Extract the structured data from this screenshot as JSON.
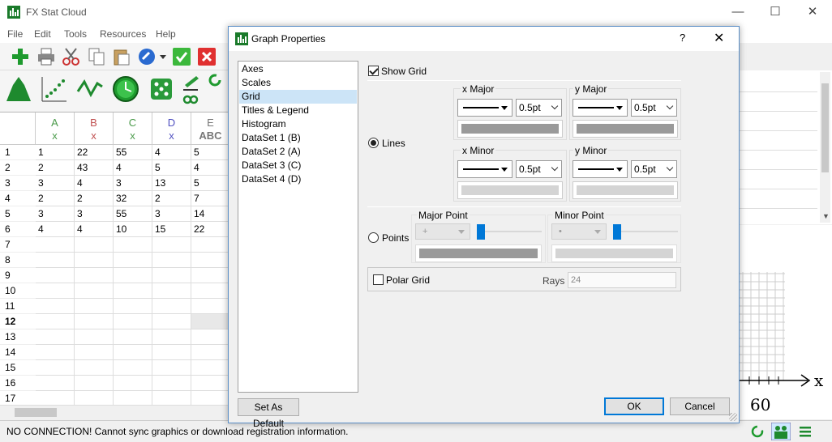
{
  "app": {
    "title": "FX Stat Cloud",
    "menu": [
      "File",
      "Edit",
      "Tools",
      "Resources",
      "Help"
    ]
  },
  "sheet": {
    "columns": [
      {
        "letter": "A",
        "type": "x"
      },
      {
        "letter": "B",
        "type": "x"
      },
      {
        "letter": "C",
        "type": "x"
      },
      {
        "letter": "D",
        "type": "x"
      },
      {
        "letter": "E",
        "type": "ABC"
      }
    ],
    "rows": [
      "1",
      "2",
      "3",
      "4",
      "5",
      "6",
      "7",
      "8",
      "9",
      "10",
      "11",
      "12",
      "13",
      "14",
      "15",
      "16",
      "17"
    ],
    "cells": [
      [
        "1",
        "22",
        "55",
        "4",
        "5"
      ],
      [
        "2",
        "43",
        "4",
        "5",
        "4"
      ],
      [
        "3",
        "4",
        "3",
        "13",
        "5"
      ],
      [
        "2",
        "2",
        "32",
        "2",
        "7"
      ],
      [
        "3",
        "3",
        "55",
        "3",
        "14"
      ],
      [
        "4",
        "4",
        "10",
        "15",
        "22"
      ]
    ],
    "column_colors": {
      "A": "#4a9a4a",
      "B": "#c05050",
      "C": "#4a9a4a",
      "D": "#5050c0",
      "E": "#777777"
    }
  },
  "plot": {
    "axis_label": "x",
    "tick_label": "60"
  },
  "status": {
    "message": "NO CONNECTION! Cannot sync graphics or download registration information."
  },
  "dialog": {
    "title": "Graph Properties",
    "help": "?",
    "nav_items": [
      "Axes",
      "Scales",
      "Grid",
      "Titles & Legend",
      "Histogram",
      "DataSet 1 (B)",
      "DataSet 2 (A)",
      "DataSet 3 (C)",
      "DataSet 4 (D)"
    ],
    "selected_nav": "Grid",
    "show_grid_label": "Show Grid",
    "lines_label": "Lines",
    "points_label": "Points",
    "x_major_label": "x Major",
    "y_major_label": "y Major",
    "x_minor_label": "x Minor",
    "y_minor_label": "y Minor",
    "x_major_size": "0.5pt",
    "y_major_size": "0.5pt",
    "x_minor_size": "0.5pt",
    "y_minor_size": "0.5pt",
    "major_point_label": "Major Point",
    "minor_point_label": "Minor Point",
    "polar_grid_label": "Polar Grid",
    "rays_label": "Rays",
    "rays_value": "24",
    "set_default_label": "Set As Default",
    "ok_label": "OK",
    "cancel_label": "Cancel",
    "show_grid_checked": true,
    "lines_selected": true,
    "polar_checked": false,
    "colors": {
      "major_grid": "#9a9a9a",
      "minor_grid": "#d4d4d4",
      "accent": "#0078d7",
      "selection": "#cce4f7"
    }
  }
}
